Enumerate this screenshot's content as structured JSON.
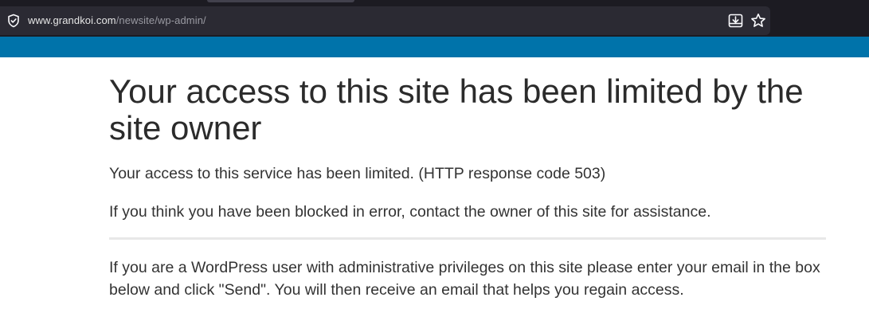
{
  "browser": {
    "url_domain": "www.grandkoi.com",
    "url_path": "/newsite/wp-admin/"
  },
  "page": {
    "title": "Your access to this site has been limited by the site owner",
    "message": "Your access to this service has been limited. (HTTP response code 503)",
    "blocked_notice": "If you think you have been blocked in error, contact the owner of this site for assistance.",
    "admin_notice": "If you are a WordPress user with administrative privileges on this site please enter your email in the box below and click \"Send\". You will then receive an email that helps you regain access."
  },
  "colors": {
    "browser_bg": "#1c1b22",
    "urlbar_bg": "#2b2a33",
    "banner": "#0073aa",
    "text": "#333333"
  },
  "icons": [
    "shield-icon",
    "save-page-icon",
    "bookmark-star-icon"
  ]
}
